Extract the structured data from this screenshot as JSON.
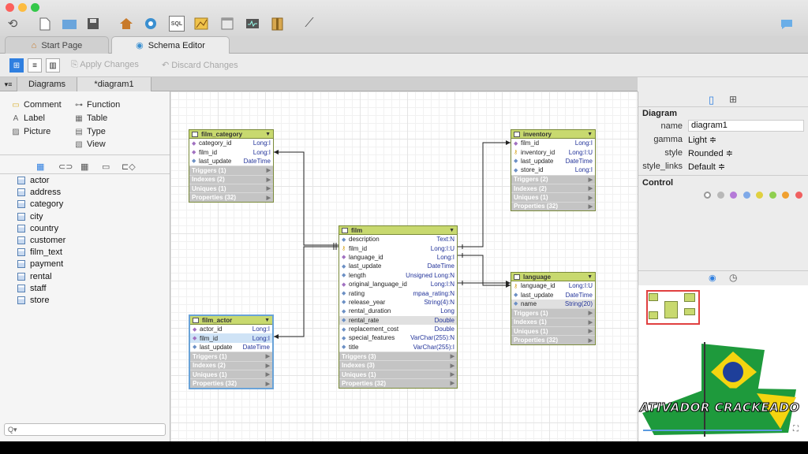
{
  "toolbar": {
    "icons": [
      "refresh-icon",
      "new-file-icon",
      "open-folder-icon",
      "save-icon",
      "home-icon",
      "schema-icon",
      "sql-icon",
      "chart-icon",
      "window-icon",
      "monitor-icon",
      "book-icon",
      "connection-icon",
      "chat-icon"
    ],
    "sql_label": "SQL"
  },
  "tabs": {
    "start": "Start Page",
    "schema": "Schema Editor"
  },
  "actions": {
    "apply": "Apply Changes",
    "discard": "Discard Changes"
  },
  "diagram_tabs": {
    "diagrams": "Diagrams",
    "current": "*diagram1"
  },
  "palette": {
    "comment": "Comment",
    "function": "Function",
    "label": "Label",
    "table": "Table",
    "picture": "Picture",
    "type": "Type",
    "view": "View"
  },
  "tables": [
    "actor",
    "address",
    "category",
    "city",
    "country",
    "customer",
    "film_text",
    "payment",
    "rental",
    "staff",
    "store"
  ],
  "search": {
    "placeholder": "Q▾"
  },
  "entities": {
    "film_category": {
      "title": "film_category",
      "rows": [
        [
          "category_id",
          "Long:I"
        ],
        [
          "film_id",
          "Long:I"
        ],
        [
          "last_update",
          "DateTime"
        ]
      ],
      "sections": [
        "Triggers (1)",
        "Indexes (2)",
        "Uniques (1)",
        "Properties (32)"
      ]
    },
    "film_actor": {
      "title": "film_actor",
      "rows": [
        [
          "actor_id",
          "Long:I"
        ],
        [
          "film_id",
          "Long:I"
        ],
        [
          "last_update",
          "DateTime"
        ]
      ],
      "sections": [
        "Triggers (1)",
        "Indexes (2)",
        "Uniques (1)",
        "Properties (32)"
      ]
    },
    "film": {
      "title": "film",
      "rows": [
        [
          "description",
          "Text:N"
        ],
        [
          "film_id",
          "Long:I:U"
        ],
        [
          "language_id",
          "Long:I"
        ],
        [
          "last_update",
          "DateTime"
        ],
        [
          "length",
          "Unsigned Long:N"
        ],
        [
          "original_language_id",
          "Long:I:N"
        ],
        [
          "rating",
          "mpaa_rating:N"
        ],
        [
          "release_year",
          "String(4):N"
        ],
        [
          "rental_duration",
          "Long"
        ],
        [
          "rental_rate",
          "Double"
        ],
        [
          "replacement_cost",
          "Double"
        ],
        [
          "special_features",
          "VarChar(255):N"
        ],
        [
          "title",
          "VarChar(255):I"
        ]
      ],
      "sections": [
        "Triggers (3)",
        "Indexes (3)",
        "Uniques (1)",
        "Properties (32)"
      ]
    },
    "inventory": {
      "title": "inventory",
      "rows": [
        [
          "film_id",
          "Long:I"
        ],
        [
          "inventory_id",
          "Long:I:U"
        ],
        [
          "last_update",
          "DateTime"
        ],
        [
          "store_id",
          "Long:I"
        ]
      ],
      "sections": [
        "Triggers (2)",
        "Indexes (2)",
        "Uniques (1)",
        "Properties (32)"
      ]
    },
    "language": {
      "title": "language",
      "rows": [
        [
          "language_id",
          "Long:I:U"
        ],
        [
          "last_update",
          "DateTime"
        ],
        [
          "name",
          "String(20)"
        ]
      ],
      "sections": [
        "Triggers (1)",
        "Indexes (1)",
        "Uniques (1)",
        "Properties (32)"
      ]
    }
  },
  "inspector": {
    "section": "Diagram",
    "props": [
      {
        "label": "name",
        "value": "diagram1"
      },
      {
        "label": "gamma",
        "value": "Light ≑"
      },
      {
        "label": "style",
        "value": "Rounded ≑"
      },
      {
        "label": "style_links",
        "value": "Default ≑"
      }
    ],
    "control": "Control"
  },
  "control_colors": [
    "#ffffff",
    "#b8b8b8",
    "#b57ad8",
    "#7fa9e8",
    "#e0d040",
    "#8fcf50",
    "#f0a030",
    "#f06060"
  ],
  "watermark": "ATIVADOR CRACKEADO"
}
